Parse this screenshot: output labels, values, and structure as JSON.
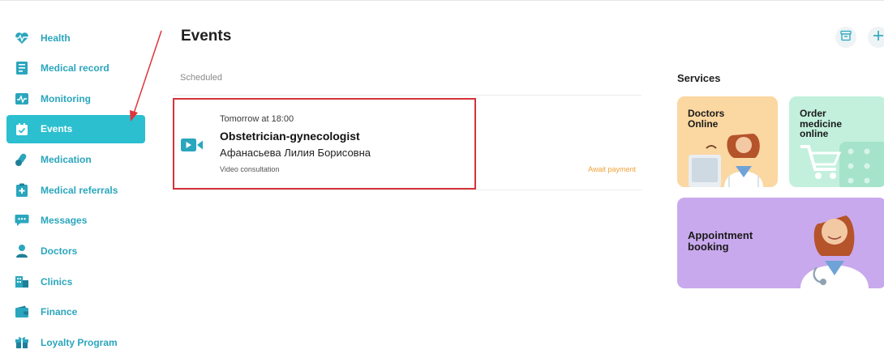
{
  "sidebar": {
    "items": [
      {
        "label": "Health",
        "icon": "heart-pulse-icon"
      },
      {
        "label": "Medical record",
        "icon": "medical-record-icon"
      },
      {
        "label": "Monitoring",
        "icon": "monitoring-icon"
      },
      {
        "label": "Events",
        "icon": "calendar-check-icon",
        "active": true
      },
      {
        "label": "Medication",
        "icon": "pills-icon"
      },
      {
        "label": "Medical referrals",
        "icon": "referral-clipboard-icon"
      },
      {
        "label": "Messages",
        "icon": "chat-icon"
      },
      {
        "label": "Doctors",
        "icon": "doctor-icon"
      },
      {
        "label": "Clinics",
        "icon": "clinic-building-icon"
      },
      {
        "label": "Finance",
        "icon": "wallet-icon"
      },
      {
        "label": "Loyalty Program",
        "icon": "gift-icon"
      }
    ]
  },
  "main": {
    "title": "Events",
    "section_label": "Scheduled",
    "event": {
      "time": "Tomorrow at 18:00",
      "specialty": "Obstetrician-gynecologist",
      "doctor": "Афанасьева Лилия Борисовна",
      "type": "Video consultation",
      "status": "Await payment",
      "icon": "video-camera-icon"
    }
  },
  "toolbar": {
    "archive_icon": "archive-icon",
    "add_icon": "plus-icon"
  },
  "services": {
    "title": "Services",
    "tiles": [
      {
        "label": "Doctors\nOnline",
        "color": "#fbd7a1"
      },
      {
        "label": "Order\nmedicine\nonline",
        "color": "#c2f0dd"
      },
      {
        "label": "Appointment\nbooking",
        "color": "#c9a9ed"
      }
    ]
  },
  "colors": {
    "accent": "#2bbfd0",
    "nav_text": "#2aa6bd",
    "status_warning": "#f0a23a",
    "highlight_border": "#d4333b"
  }
}
